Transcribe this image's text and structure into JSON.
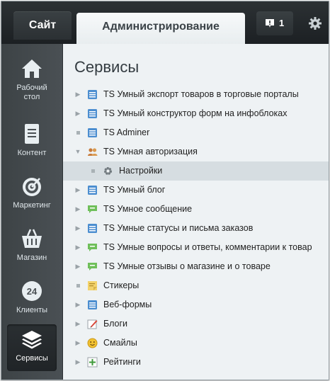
{
  "topbar": {
    "site_tab": "Сайт",
    "admin_tab": "Администрирование",
    "notify_count": "1"
  },
  "sidebar": {
    "items": [
      {
        "label_line1": "Рабочий",
        "label_line2": "стол",
        "icon": "home-icon"
      },
      {
        "label_line1": "Контент",
        "label_line2": "",
        "icon": "document-icon"
      },
      {
        "label_line1": "Маркетинг",
        "label_line2": "",
        "icon": "target-icon"
      },
      {
        "label_line1": "Магазин",
        "label_line2": "",
        "icon": "basket-icon"
      },
      {
        "label_line1": "Клиенты",
        "label_line2": "",
        "icon": "clients-24-icon",
        "badge": "24"
      },
      {
        "label_line1": "Сервисы",
        "label_line2": "",
        "icon": "layers-icon",
        "active": true
      }
    ]
  },
  "main": {
    "title": "Сервисы",
    "tree": [
      {
        "label": "TS Умный экспорт товаров в торговые порталы",
        "marker": "arrow-right",
        "icon": "form-icon"
      },
      {
        "label": "TS Умный конструктор форм на инфоблоках",
        "marker": "arrow-right",
        "icon": "form-icon"
      },
      {
        "label": "TS Adminer",
        "marker": "dot",
        "icon": "form-icon"
      },
      {
        "label": "TS Умная авторизация",
        "marker": "arrow-down",
        "icon": "users-icon"
      },
      {
        "label": "Настройки",
        "marker": "dot",
        "icon": "gear-icon",
        "child": true,
        "selected": true
      },
      {
        "label": "TS Умный блог",
        "marker": "arrow-right",
        "icon": "form-icon"
      },
      {
        "label": "TS Умное сообщение",
        "marker": "arrow-right",
        "icon": "chat-icon"
      },
      {
        "label": "TS Умные статусы и письма заказов",
        "marker": "arrow-right",
        "icon": "form-icon"
      },
      {
        "label": "TS Умные вопросы и ответы, комментарии к товар",
        "marker": "arrow-right",
        "icon": "chat-icon"
      },
      {
        "label": "TS Умные отзывы о магазине и о товаре",
        "marker": "arrow-right",
        "icon": "chat-icon"
      },
      {
        "label": "Стикеры",
        "marker": "dot",
        "icon": "sticker-icon"
      },
      {
        "label": "Веб-формы",
        "marker": "arrow-right",
        "icon": "form-icon"
      },
      {
        "label": "Блоги",
        "marker": "arrow-right",
        "icon": "blog-icon"
      },
      {
        "label": "Смайлы",
        "marker": "arrow-right",
        "icon": "smile-icon"
      },
      {
        "label": "Рейтинги",
        "marker": "arrow-right",
        "icon": "rating-icon"
      }
    ]
  },
  "colors": {
    "topbar": "#1f2326",
    "sidebar": "#43494c",
    "main_bg": "#eef2f4",
    "selected_row": "#d6dde1"
  }
}
